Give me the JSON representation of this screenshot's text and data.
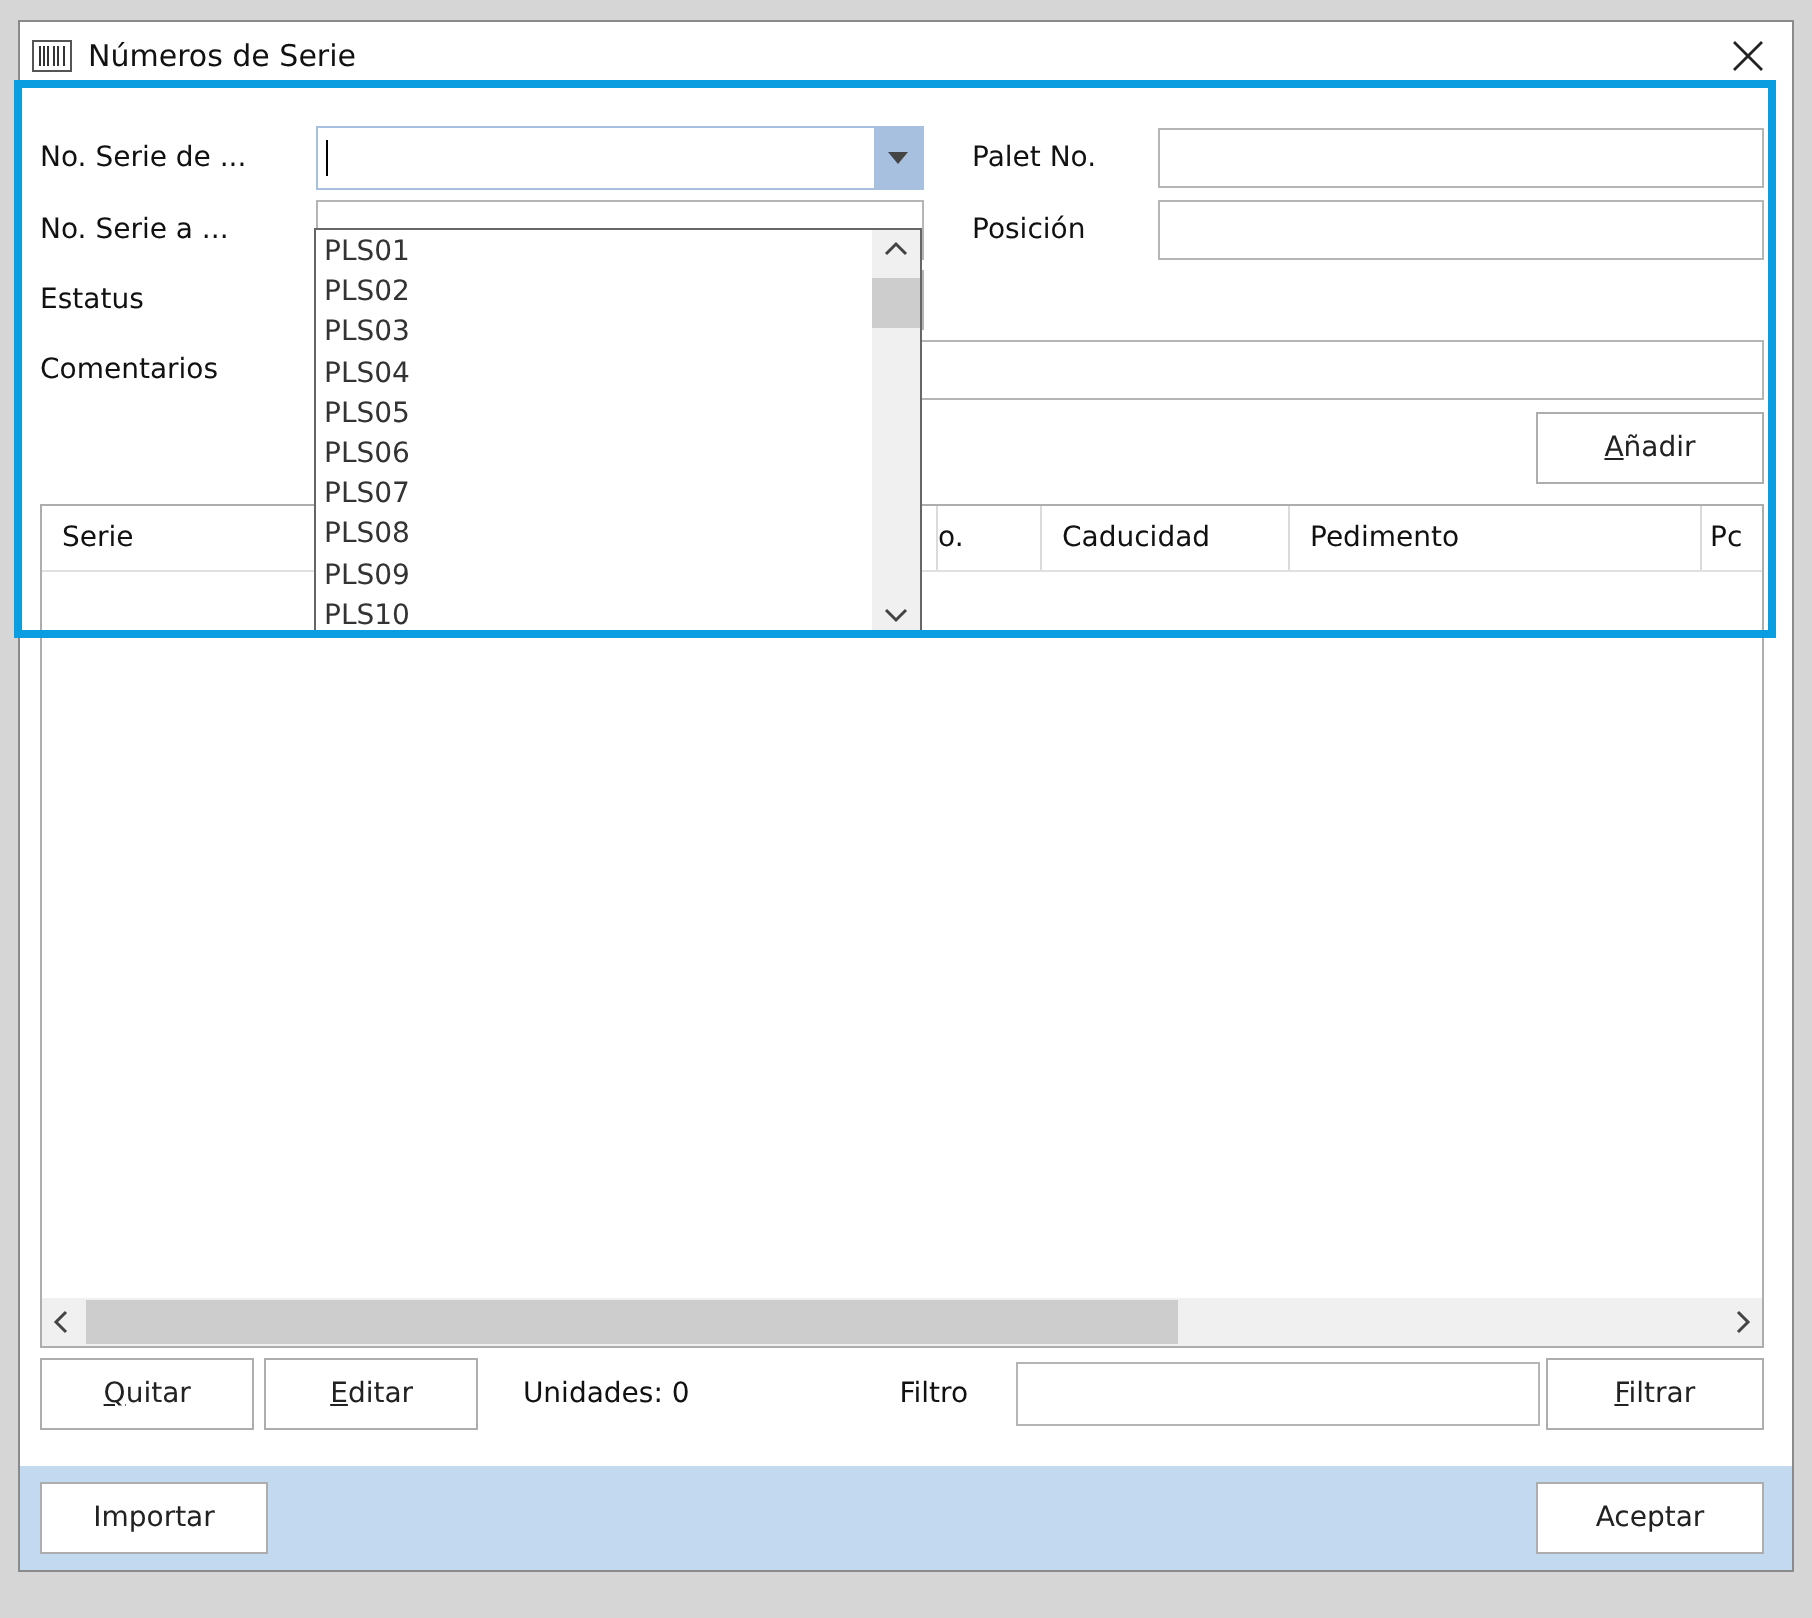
{
  "window": {
    "title": "Números de Serie"
  },
  "form": {
    "serie_from": {
      "label": "No. Serie de ...",
      "expanded": true,
      "options": [
        "PLS01",
        "PLS02",
        "PLS03",
        "PLS04",
        "PLS05",
        "PLS06",
        "PLS07",
        "PLS08",
        "PLS09",
        "PLS10"
      ]
    },
    "serie_to": {
      "label": "No. Serie a ..."
    },
    "status": {
      "label": "Estatus"
    },
    "comments": {
      "label": "Comentarios"
    },
    "pallet": {
      "label": "Palet No."
    },
    "position": {
      "label": "Posición"
    },
    "add_button": {
      "label": "Añadir",
      "mnemonic": true
    }
  },
  "table": {
    "columns": [
      {
        "label": "Serie"
      },
      {
        "label": "o."
      },
      {
        "label": "Caducidad"
      },
      {
        "label": "Pedimento"
      },
      {
        "label": "Pc"
      }
    ]
  },
  "bottom_bar": {
    "buttons": [
      {
        "label": "Quitar",
        "mnemonic": true
      },
      {
        "label": "Editar",
        "mnemonic": true
      }
    ],
    "units": "Unidades: 0",
    "filter_label": "Filtro",
    "filter_button": {
      "label": "Filtrar",
      "mnemonic": true
    }
  },
  "footer": {
    "buttons": [
      {
        "label": "Importar",
        "mnemonic": false
      },
      {
        "label": "Aceptar",
        "mnemonic": false
      }
    ]
  }
}
